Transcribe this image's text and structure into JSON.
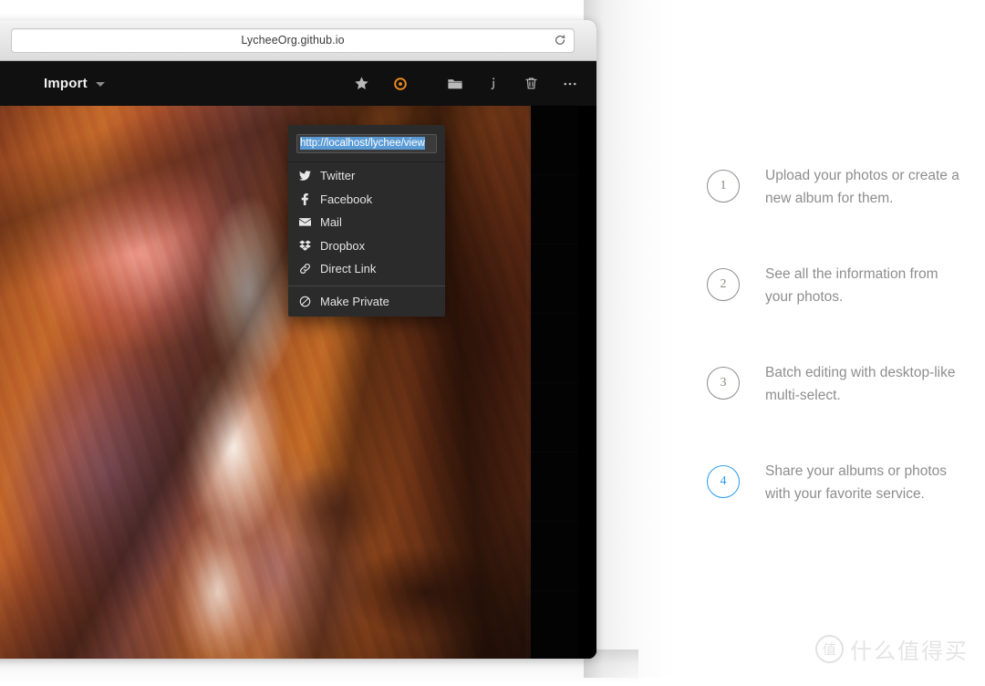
{
  "browser": {
    "url_text": "LycheeOrg.github.io",
    "reload_icon": "reload-icon"
  },
  "app": {
    "toolbar": {
      "import_label": "Import",
      "chevron_icon": "chevron-down-icon",
      "actions": [
        {
          "name": "star-icon",
          "label": "Star"
        },
        {
          "name": "share-icon",
          "label": "Share",
          "color": "#f08b20",
          "active": true
        },
        {
          "name": "folder-icon",
          "label": "Move to album"
        },
        {
          "name": "info-icon",
          "label": "Info"
        },
        {
          "name": "trash-icon",
          "label": "Delete"
        },
        {
          "name": "more-icon",
          "label": "More"
        }
      ]
    },
    "share_menu": {
      "url_value": "http://localhost/lychee/view",
      "url_selected": true,
      "items": [
        {
          "icon": "twitter-icon",
          "label": "Twitter"
        },
        {
          "icon": "facebook-icon",
          "label": "Facebook"
        },
        {
          "icon": "mail-icon",
          "label": "Mail"
        },
        {
          "icon": "dropbox-icon",
          "label": "Dropbox"
        },
        {
          "icon": "link-icon",
          "label": "Direct Link"
        }
      ],
      "divider_after": 5,
      "private_item": {
        "icon": "ban-icon",
        "label": "Make Private"
      }
    },
    "photo": {
      "alt": "Antelope Canyon sandstone walls with light shaft"
    }
  },
  "features": [
    {
      "number": "1",
      "text": "Upload your photos or create a new album for them.",
      "accent": false
    },
    {
      "number": "2",
      "text": "See all the information from your photos.",
      "accent": false
    },
    {
      "number": "3",
      "text": "Batch editing with desktop-like multi-select.",
      "accent": false
    },
    {
      "number": "4",
      "text": "Share your albums or photos with your favorite service.",
      "accent": true
    }
  ],
  "watermark": {
    "badge": "值",
    "text": "什么值得买"
  },
  "colors": {
    "accent_blue": "#2b9bf0",
    "accent_orange": "#f08b20",
    "selection_blue": "#5b9bd5",
    "menu_bg": "#2b2b2b",
    "app_bg": "#0c0c0c"
  }
}
